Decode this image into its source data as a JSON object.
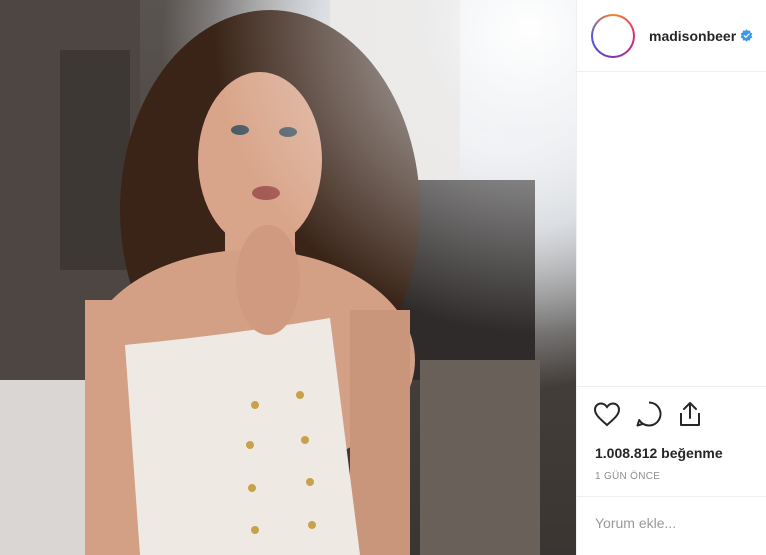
{
  "photo": {
    "alt": ""
  },
  "header": {
    "username": "madisonbeer",
    "verified_icon": "verified-badge-icon"
  },
  "actions": {
    "icons": [
      "heart-icon",
      "comment-icon",
      "share-icon"
    ],
    "likes": "1.008.812 beğenme",
    "time_ago": "1 GÜN ÖNCE"
  },
  "comment": {
    "placeholder": "Yorum ekle..."
  },
  "colors": {
    "verified": "#3897f0",
    "text": "#262626",
    "muted": "#8e8e8e",
    "border": "#efefef"
  }
}
